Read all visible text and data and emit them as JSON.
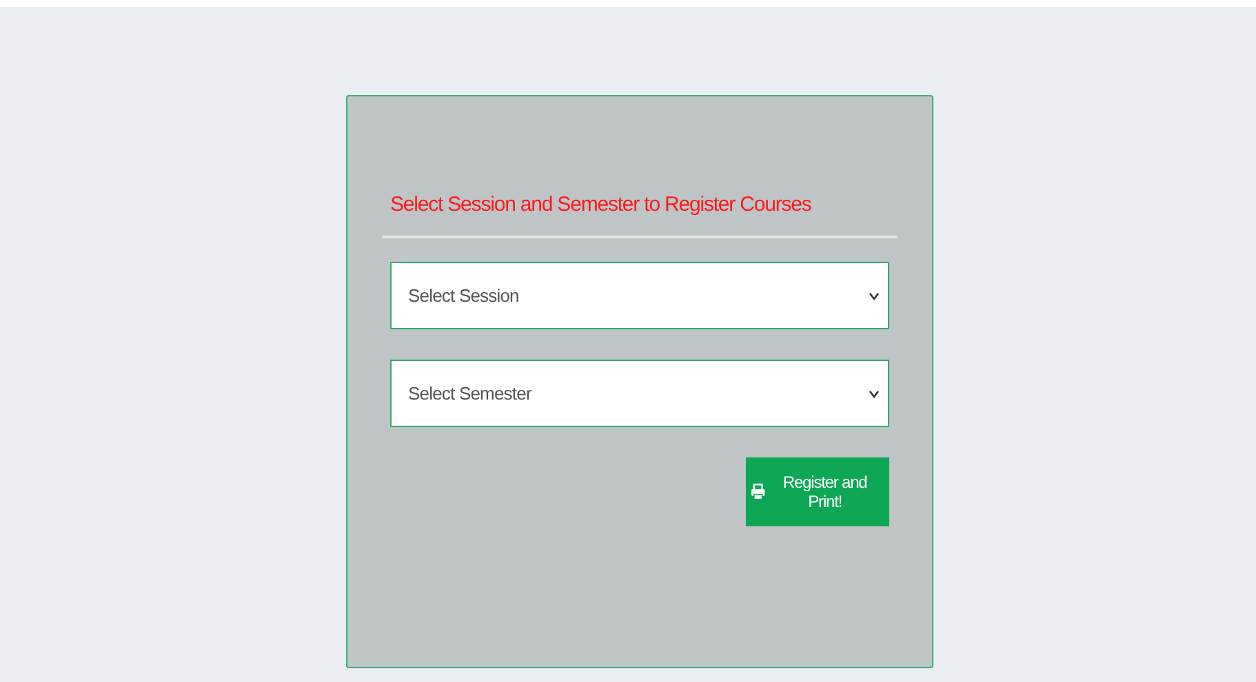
{
  "form": {
    "title": "Select Session and Semester to Register Courses",
    "selects": [
      {
        "placeholder": "Select Session"
      },
      {
        "placeholder": "Select Semester"
      }
    ],
    "submit_button": {
      "label": "Register and Print!"
    }
  }
}
